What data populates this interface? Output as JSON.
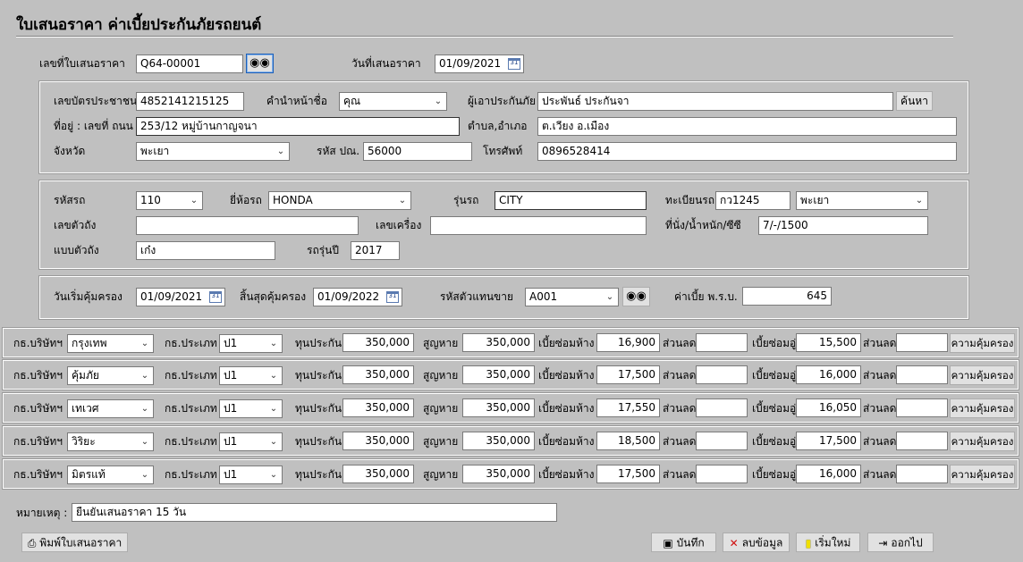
{
  "header": {
    "title": "ใบเสนอราคา ค่าเบี้ยประกันภัยรถยนต์",
    "quote_no_label": "เลขที่ใบเสนอราคา",
    "quote_no": "Q64-00001",
    "quote_date_label": "วันที่เสนอราคา",
    "quote_date": "01/09/2021"
  },
  "customer": {
    "id_card_label": "เลขบัตรประชาชน",
    "id_card": "4852141215125",
    "prefix_label": "คำนำหน้าชื่อ",
    "prefix": "คุณ",
    "insured_label": "ผู้เอาประกันภัย",
    "insured": "ประพันธ์ ประกันจา",
    "search_label": "ค้นหา",
    "address_label": "ที่อยู่ : เลขที่ ถนน",
    "address": "253/12 หมู่บ้านกาญจนา",
    "subdistrict_label": "ตำบล,อำเภอ",
    "subdistrict": "ต.เวียง อ.เมือง",
    "province_label": "จังหวัด",
    "province": "พะเยา",
    "postcode_label": "รหัส ปณ.",
    "postcode": "56000",
    "phone_label": "โทรศัพท์",
    "phone": "0896528414"
  },
  "vehicle": {
    "code_label": "รหัสรถ",
    "code": "110",
    "brand_label": "ยี่ห้อรถ",
    "brand": "HONDA",
    "model_label": "รุ่นรถ",
    "model": "CITY",
    "plate_label": "ทะเบียนรถ",
    "plate": "กว1245",
    "plate_province": "พะเยา",
    "chassis_label": "เลขตัวถัง",
    "chassis": "",
    "engine_label": "เลขเครื่อง",
    "engine": "",
    "seat_label": "ที่นั่ง/น้ำหนัก/ซีซี",
    "seat": "7/-/1500",
    "body_label": "แบบตัวถัง",
    "body": "เก๋ง",
    "year_label": "รถรุ่นปี",
    "year": "2017"
  },
  "coverage": {
    "start_label": "วันเริ่มคุ้มครอง",
    "start": "01/09/2021",
    "end_label": "สิ้นสุดคุ้มครอง",
    "end": "01/09/2022",
    "agent_label": "รหัสตัวแทนขาย",
    "agent": "A001",
    "prb_label": "ค่าเบี้ย พ.ร.บ.",
    "prb": "645"
  },
  "quote_labels": {
    "company": "กธ.บริษัทฯ",
    "type": "กธ.ประเภท",
    "sum_insured": "ทุนประกัน",
    "loss": "สูญหาย",
    "garage": "เบี้ยซ่อมห้าง",
    "discount": "ส่วนลด",
    "local": "เบี้ยซ่อมอู่",
    "coverage_btn": "ความคุ้มครอง"
  },
  "quotes": [
    {
      "company": "กรุงเทพ",
      "type": "ป1",
      "sum_insured": "350,000",
      "loss": "350,000",
      "garage": "16,900",
      "discount1": "",
      "local": "15,500",
      "discount2": ""
    },
    {
      "company": "คุ้มภัย",
      "type": "ป1",
      "sum_insured": "350,000",
      "loss": "350,000",
      "garage": "17,500",
      "discount1": "",
      "local": "16,000",
      "discount2": ""
    },
    {
      "company": "เทเวศ",
      "type": "ป1",
      "sum_insured": "350,000",
      "loss": "350,000",
      "garage": "17,550",
      "discount1": "",
      "local": "16,050",
      "discount2": ""
    },
    {
      "company": "วิริยะ",
      "type": "ป1",
      "sum_insured": "350,000",
      "loss": "350,000",
      "garage": "18,500",
      "discount1": "",
      "local": "17,500",
      "discount2": ""
    },
    {
      "company": "มิตรแท้",
      "type": "ป1",
      "sum_insured": "350,000",
      "loss": "350,000",
      "garage": "17,500",
      "discount1": "",
      "local": "16,000",
      "discount2": ""
    }
  ],
  "footer": {
    "remark_label": "หมายเหตุ :",
    "remark": "ยืนยันเสนอราคา 15 วัน",
    "print_label": "พิมพ์ใบเสนอราคา",
    "save_label": "บันทึก",
    "delete_label": "ลบข้อมูล",
    "new_label": "เริ่มใหม่",
    "exit_label": "ออกไป"
  },
  "icons": {
    "binoculars": "binoculars-icon",
    "calendar": "calendar-icon",
    "chevron": "chevron-down-icon",
    "printer": "printer-icon",
    "save": "floppy-disk-icon",
    "delete": "red-x-icon",
    "new": "new-page-icon",
    "exit": "exit-door-icon"
  },
  "colors": {
    "background": "#c0c0c0",
    "field": "#ffffff",
    "button": "#e1e1e1",
    "delete_icon": "#d01010",
    "new_icon": "#f0e000"
  }
}
